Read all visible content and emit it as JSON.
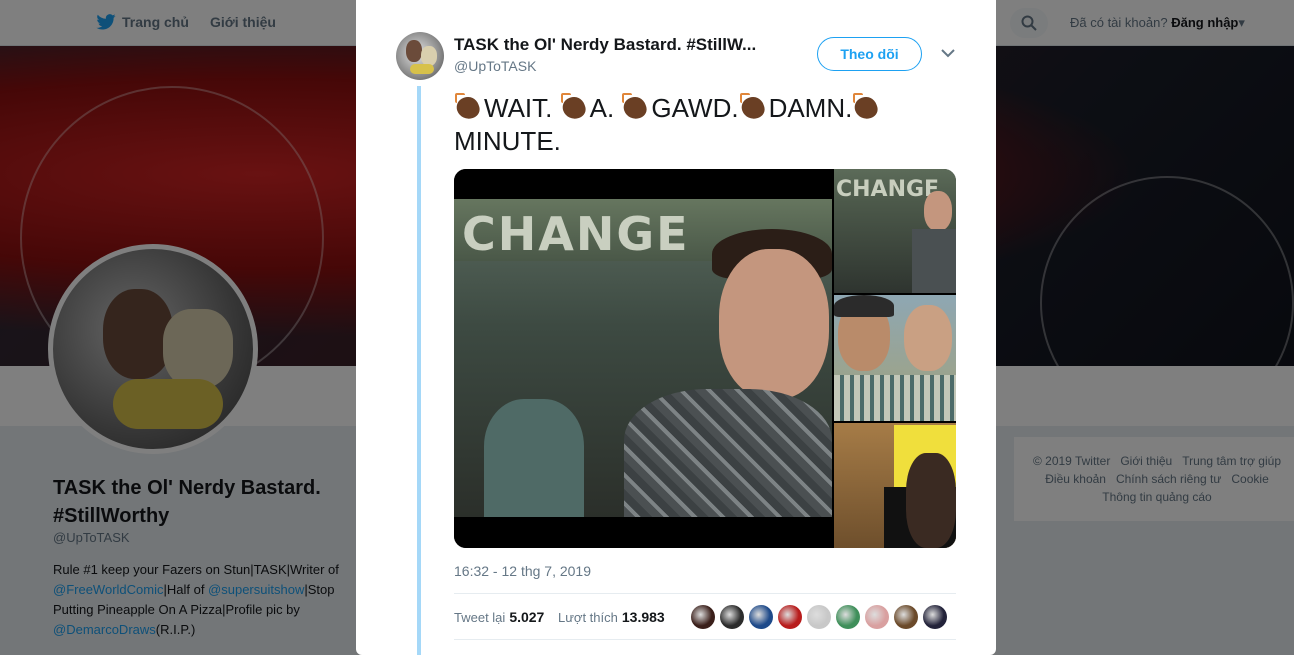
{
  "topbar": {
    "home_label": "Trang chủ",
    "about_label": "Giới thiệu",
    "login_question": "Đã có tài khoản?",
    "login_label": "Đăng nhập"
  },
  "profile": {
    "name": "TASK the Ol' Nerdy Bastard. #StillWorthy",
    "handle": "@UpToTASK",
    "bio": {
      "p1": "Rule #1 keep your Fazers on Stun|TASK|Writer of ",
      "link1": "@FreeWorldComic",
      "p2": "|Half of ",
      "link2": "@supersuitshow",
      "p3": "|Stop Putting Pineapple On A Pizza|Profile pic by ",
      "link3": "@DemarcoDraws",
      "p4": "(R.I.P.)"
    }
  },
  "footer": {
    "copyright": "© 2019 Twitter",
    "about": "Giới thiệu",
    "help": "Trung tâm trợ giúp",
    "terms": "Điều khoản",
    "privacy": "Chính sách riêng tư",
    "cookie": "Cookie",
    "ads": "Thông tin quảng cáo"
  },
  "tweet": {
    "author_name": "TASK the Ol' Nerdy Bastard. #StillW...",
    "author_handle": "@UpToTASK",
    "follow_label": "Theo dõi",
    "text_words": [
      "WAIT.",
      "A.",
      "GAWD.",
      "DAMN.",
      "MINUTE."
    ],
    "text_icon": "clapping-hands-dark-skin-emoji",
    "video_sign_text": "CHANGE",
    "video_sign_text_small": "CHANGE",
    "timestamp": "16:32 - 12 thg 7, 2019",
    "retweets_label": "Tweet lại",
    "retweets_count": "5.027",
    "likes_label": "Lượt thích",
    "likes_count": "13.983",
    "liker_colors": [
      "#3a1f1a",
      "#2c2c2c",
      "#1e4a8a",
      "#b81c1c",
      "#c8c8c8",
      "#3f8f5a",
      "#d9a0a0",
      "#6b4a2a",
      "#23233a"
    ]
  },
  "colors": {
    "accent": "#1da1f2",
    "thread_line": "#a5d8f8"
  }
}
